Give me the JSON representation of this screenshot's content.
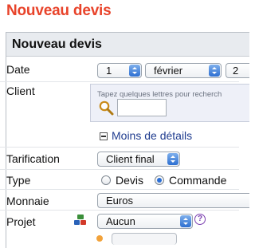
{
  "page": {
    "title": "Nouveau devis"
  },
  "panel": {
    "title": "Nouveau devis"
  },
  "form": {
    "date": {
      "label": "Date",
      "day": "1",
      "month": "février",
      "year_partial": "2"
    },
    "client": {
      "label": "Client",
      "hint": "Tapez quelques lettres pour recherch"
    },
    "toggle": {
      "label": "Moins de détails"
    },
    "tarification": {
      "label": "Tarification",
      "value": "Client final"
    },
    "type": {
      "label": "Type",
      "options": [
        {
          "label": "Devis",
          "checked": false
        },
        {
          "label": "Commande",
          "checked": true
        }
      ]
    },
    "monnaie": {
      "label": "Monnaie",
      "value": "Euros"
    },
    "projet": {
      "label": "Projet",
      "value": "Aucun",
      "help": "?"
    }
  },
  "colors": {
    "title_red": "#e8432a",
    "header_bg": "#e8ebef",
    "link_blue": "#1f3c8f",
    "select_arrow_blue": "#2d6fd1",
    "help_purple": "#7b3fb0"
  },
  "icons": {
    "client_search": "magnifier-icon",
    "project": "project-cubes-icon",
    "help": "help-icon",
    "toggle": "collapse-minus-icon"
  }
}
